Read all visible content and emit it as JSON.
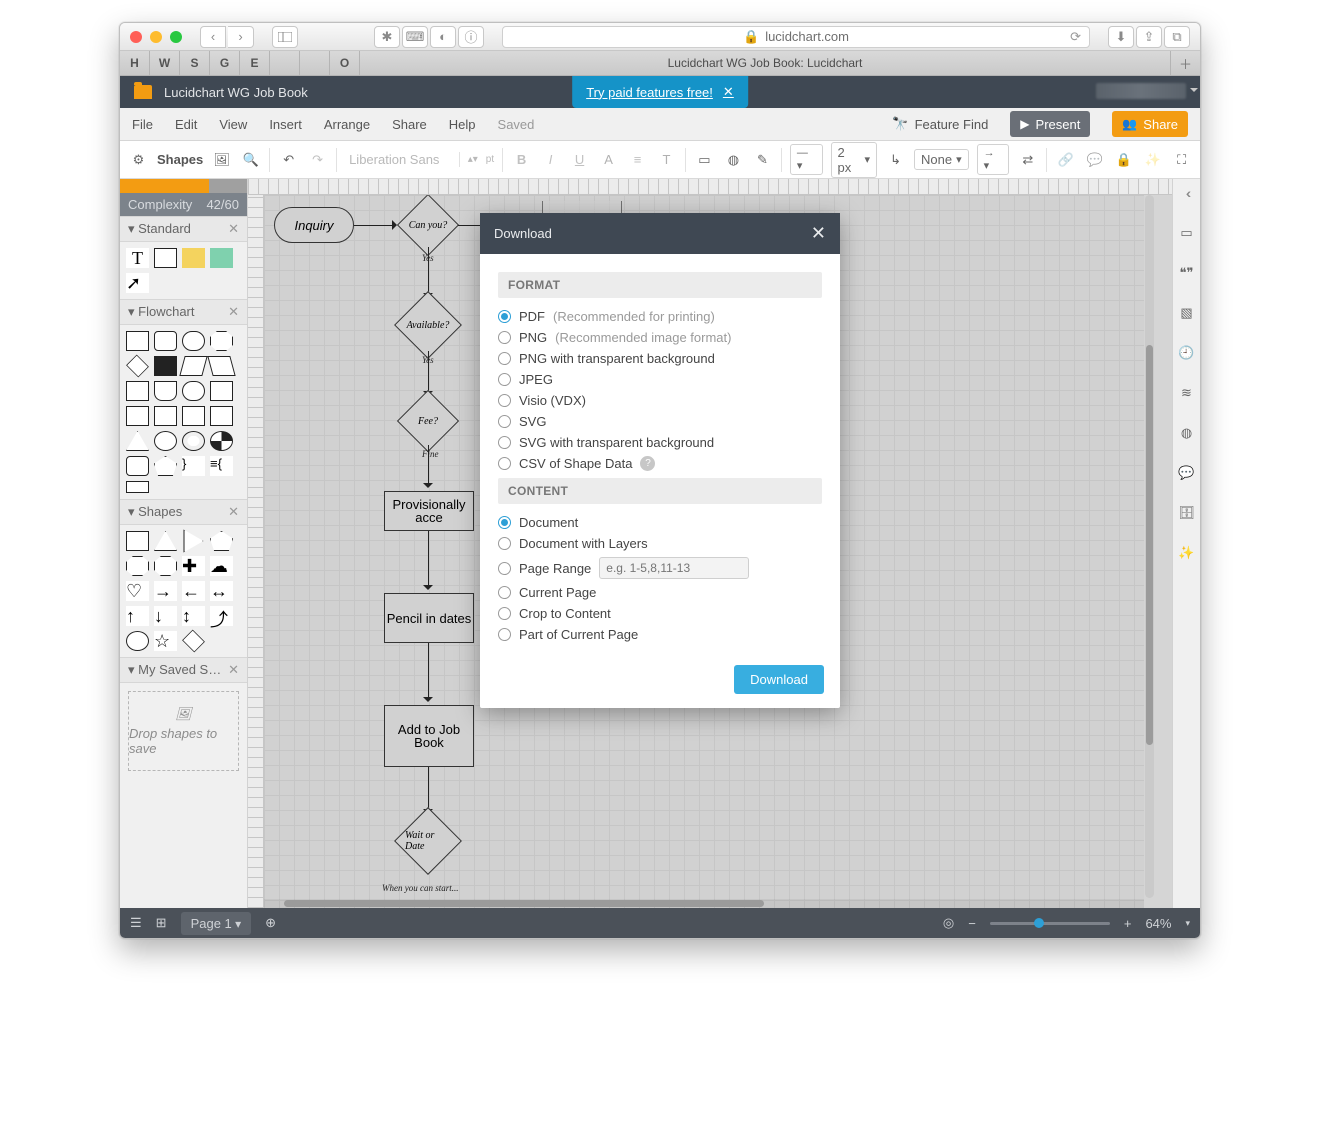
{
  "browser": {
    "host": "lucidchart.com",
    "tab_title": "Lucidchart WG Job Book: Lucidchart",
    "favs": [
      "H",
      "W",
      "S",
      "G",
      "E",
      "",
      "",
      "O"
    ]
  },
  "header": {
    "doc_title": "Lucidchart WG Job Book",
    "try_text": "Try paid features free!"
  },
  "menu": {
    "items": [
      "File",
      "Edit",
      "View",
      "Insert",
      "Arrange",
      "Share",
      "Help"
    ],
    "saved": "Saved",
    "feature_find": "Feature Find",
    "present": "Present",
    "share": "Share"
  },
  "toolbar": {
    "shapes": "Shapes",
    "font": "Liberation Sans",
    "pt": "pt",
    "stroke_width": "2 px",
    "line_end": "None"
  },
  "left": {
    "complexity_label": "Complexity",
    "complexity_value": "42/60",
    "groups": {
      "standard": "Standard",
      "flowchart": "Flowchart",
      "shapes": "Shapes",
      "saved": "My Saved S…"
    },
    "drop_hint": "Drop shapes to save"
  },
  "flow": {
    "inquiry": "Inquiry",
    "can": "Can you?",
    "yes1": "Yes",
    "avail": "Available?",
    "yes2": "Yes",
    "fee": "Fee?",
    "fine": "Fine",
    "prov": "Provisionally acce",
    "pencil": "Pencil in dates",
    "add": "Add to Job Book",
    "wait": "Wait or Date",
    "when": "When you can start..."
  },
  "modal": {
    "title": "Download",
    "format_head": "FORMAT",
    "content_head": "CONTENT",
    "formats": {
      "pdf": "PDF",
      "pdf_hint": "(Recommended for printing)",
      "png": "PNG",
      "png_hint": "(Recommended image format)",
      "png_t": "PNG with transparent background",
      "jpeg": "JPEG",
      "visio": "Visio (VDX)",
      "svg": "SVG",
      "svg_t": "SVG with transparent background",
      "csv": "CSV of Shape Data"
    },
    "content": {
      "doc": "Document",
      "layers": "Document with Layers",
      "range": "Page Range",
      "range_ph": "e.g. 1-5,8,11-13",
      "current": "Current Page",
      "crop": "Crop to Content",
      "part": "Part of Current Page"
    },
    "download_btn": "Download"
  },
  "footer": {
    "page": "Page 1",
    "zoom": "64%"
  }
}
